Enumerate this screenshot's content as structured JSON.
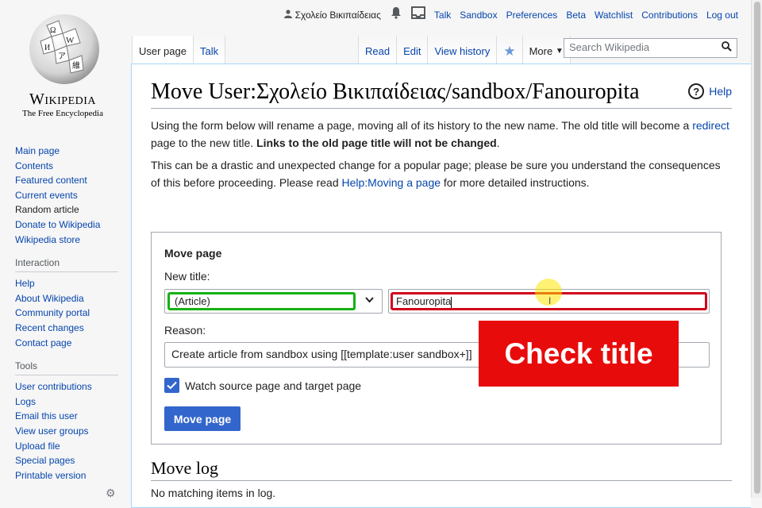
{
  "personal": {
    "username": "Σχολείο Βικιπαίδειας",
    "links": [
      "Talk",
      "Sandbox",
      "Preferences",
      "Beta",
      "Watchlist",
      "Contributions",
      "Log out"
    ]
  },
  "logo": {
    "wordmark": "Wikipedia",
    "tagline": "The Free Encyclopedia"
  },
  "sidebar": {
    "main": [
      "Main page",
      "Contents",
      "Featured content",
      "Current events",
      "Random article",
      "Donate to Wikipedia",
      "Wikipedia store"
    ],
    "interaction_heading": "Interaction",
    "interaction": [
      "Help",
      "About Wikipedia",
      "Community portal",
      "Recent changes",
      "Contact page"
    ],
    "tools_heading": "Tools",
    "tools": [
      "User contributions",
      "Logs",
      "Email this user",
      "View user groups",
      "Upload file",
      "Special pages",
      "Printable version"
    ]
  },
  "tabs": {
    "left": [
      "User page",
      "Talk"
    ],
    "right": [
      "Read",
      "Edit",
      "View history"
    ],
    "more": "More"
  },
  "search": {
    "placeholder": "Search Wikipedia"
  },
  "page": {
    "title": "Move User:Σχολείο Βικιπαίδειας/sandbox/Fanouropita",
    "help": "Help",
    "intro1_a": "Using the form below will rename a page, moving all of its history to the new name. The old title will become a ",
    "intro1_link": "redirect",
    "intro1_b": " page to the new title. ",
    "intro1_bold": "Links to the old page title will not be changed",
    "intro1_end": ".",
    "intro2_a": "This can be a drastic and unexpected change for a popular page; please be sure you understand the consequences of this before proceeding. Please read ",
    "intro2_link": "Help:Moving a page",
    "intro2_b": " for more detailed instructions."
  },
  "form": {
    "legend": "Move page",
    "new_title_label": "New title:",
    "namespace": "(Article)",
    "title_value": "Fanouropita",
    "reason_label": "Reason:",
    "reason_value": "Create article from sandbox using [[template:user sandbox+]]",
    "watch_label": "Watch source page and target page",
    "watch_checked": true,
    "submit": "Move page"
  },
  "overlay": {
    "text": "Check title"
  },
  "movelog": {
    "heading": "Move log",
    "empty": "No matching items in log."
  }
}
